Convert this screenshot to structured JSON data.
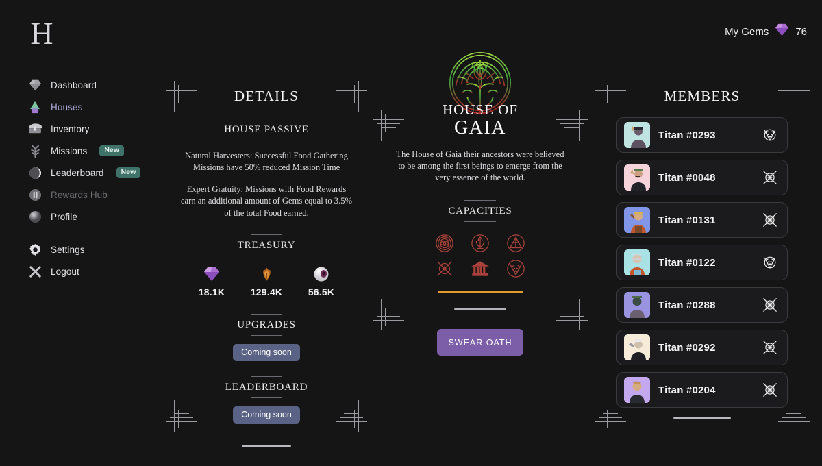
{
  "app": {
    "logo_letter": "H",
    "bg": "#151515"
  },
  "topbar": {
    "gems_label": "My Gems",
    "gems_value": "76",
    "gem_icon": "gem-icon"
  },
  "sidebar": {
    "items": [
      {
        "label": "Dashboard",
        "icon": "gem-icon",
        "state": "default",
        "badge": null
      },
      {
        "label": "Houses",
        "icon": "house-icon",
        "state": "active",
        "badge": null
      },
      {
        "label": "Inventory",
        "icon": "chest-icon",
        "state": "default",
        "badge": null
      },
      {
        "label": "Missions",
        "icon": "wheat-icon",
        "state": "default",
        "badge": "New"
      },
      {
        "label": "Leaderboard",
        "icon": "orb-icon",
        "state": "default",
        "badge": "New"
      },
      {
        "label": "Rewards Hub",
        "icon": "coin-icon",
        "state": "muted",
        "badge": null
      },
      {
        "label": "Profile",
        "icon": "sphere-icon",
        "state": "default",
        "badge": null
      }
    ],
    "footer_items": [
      {
        "label": "Settings",
        "icon": "gear-icon",
        "state": "default"
      },
      {
        "label": "Logout",
        "icon": "logout-icon",
        "state": "default"
      }
    ]
  },
  "details": {
    "title": "DETAILS",
    "passive": {
      "heading": "HOUSE PASSIVE",
      "p1": "Natural Harvesters: Successful Food Gathering Missions have 50% reduced Mission Time",
      "p2": "Expert Gratuity: Missions with Food Rewards earn an additional amount of Gems equal to 3.5% of the total Food earned."
    },
    "treasury": {
      "heading": "TREASURY",
      "items": [
        {
          "icon": "gem-icon",
          "value": "18.1K"
        },
        {
          "icon": "food-icon",
          "value": "129.4K"
        },
        {
          "icon": "eye-icon",
          "value": "56.5K"
        }
      ]
    },
    "upgrades": {
      "heading": "UPGRADES",
      "button": "Coming soon"
    },
    "leaderboard": {
      "heading": "LEADERBOARD",
      "button": "Coming soon"
    }
  },
  "house": {
    "emblem": "tree-of-life-icon",
    "name_line1": "HOUSE OF",
    "name_line2": "GAIA",
    "description": "The House of Gaia their ancestors were believed to be among the first beings to emerge from the very essence of the world.",
    "capacities": {
      "heading": "CAPACITIES",
      "icons": [
        "eye-sigil-icon",
        "trident-sigil-icon",
        "pyramid-sigil-icon",
        "crossed-swords-sigil-icon",
        "temple-sigil-icon",
        "wheat-sigil-icon"
      ]
    },
    "progress_color": "#e39b32",
    "oath_button": "SWEAR OATH",
    "oath_button_color": "#7b5ea7"
  },
  "members": {
    "title": "MEMBERS",
    "rows": [
      {
        "name": "Titan #0293",
        "avatar_bg": "#bfe3e0",
        "badge": "wheat-sigil-icon"
      },
      {
        "name": "Titan #0048",
        "avatar_bg": "#f6d2da",
        "badge": "crossed-swords-sigil-icon"
      },
      {
        "name": "Titan #0131",
        "avatar_bg": "#8196e8",
        "badge": "crossed-swords-sigil-icon"
      },
      {
        "name": "Titan #0122",
        "avatar_bg": "#a9e2e5",
        "badge": "wheat-sigil-icon"
      },
      {
        "name": "Titan #0288",
        "avatar_bg": "#9a93e0",
        "badge": "crossed-swords-sigil-icon"
      },
      {
        "name": "Titan #0292",
        "avatar_bg": "#f7ecd9",
        "badge": "crossed-swords-sigil-icon"
      },
      {
        "name": "Titan #0204",
        "avatar_bg": "#c3a8ef",
        "badge": "crossed-swords-sigil-icon"
      }
    ]
  }
}
